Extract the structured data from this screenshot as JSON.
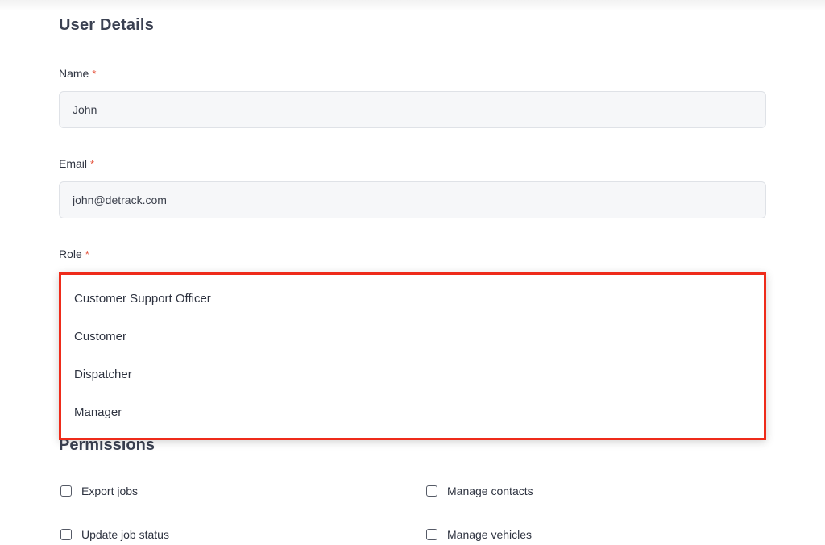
{
  "form": {
    "title": "User Details",
    "required_marker": "*",
    "name": {
      "label": "Name",
      "value": "John"
    },
    "email": {
      "label": "Email",
      "value": "john@detrack.com"
    },
    "role": {
      "label": "Role",
      "options": [
        "Customer Support Officer",
        "Customer",
        "Dispatcher",
        "Manager"
      ]
    }
  },
  "highlight_color": "#ee2b1a",
  "permissions": {
    "title": "Permissions",
    "items": [
      {
        "label": "Export jobs",
        "checked": false
      },
      {
        "label": "Manage contacts",
        "checked": false
      },
      {
        "label": "Update job status",
        "checked": false
      },
      {
        "label": "Manage vehicles",
        "checked": false
      }
    ]
  }
}
